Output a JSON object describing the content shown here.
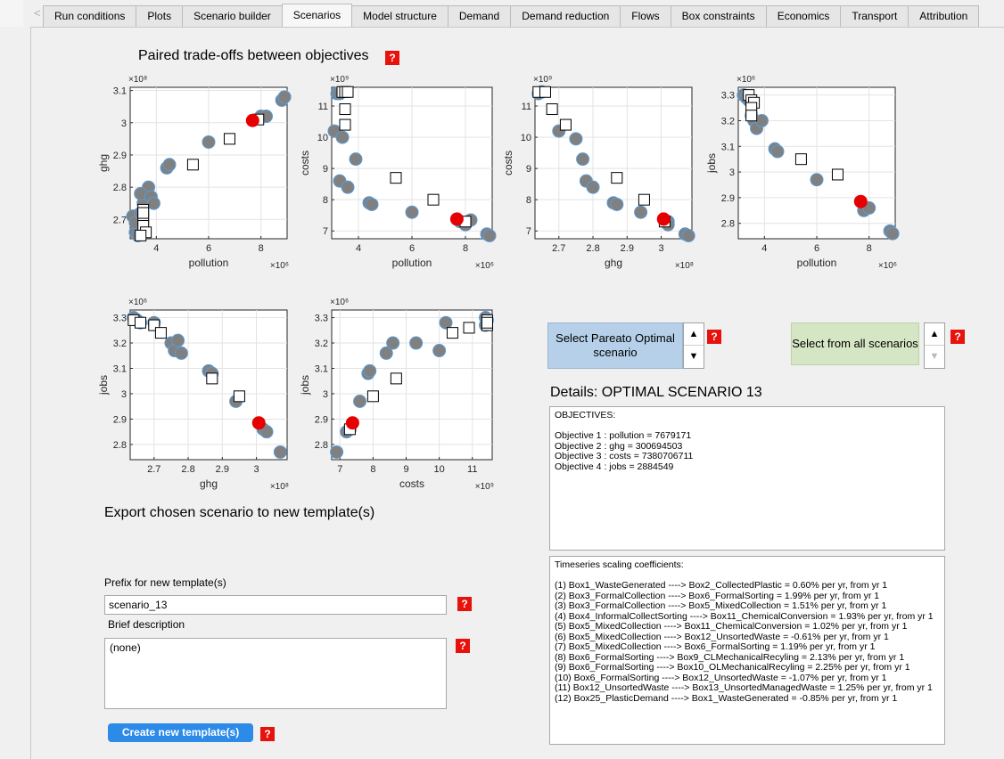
{
  "tabs": [
    "Run conditions",
    "Plots",
    "Scenario builder",
    "Scenarios",
    "Model structure",
    "Demand",
    "Demand reduction",
    "Flows",
    "Box constraints",
    "Economics",
    "Transport",
    "Attribution"
  ],
  "active_tab": "Scenarios",
  "heading": "Paired trade-offs between objectives",
  "help_label": "?",
  "plots": [
    {
      "xlabel": "pollution",
      "ylabel": "ghg",
      "x_exp": "×10⁶",
      "y_exp": "×10⁸",
      "xticks": [
        "4",
        "6",
        "8"
      ],
      "yticks": [
        "3.1",
        "3",
        "2.9",
        "2.8",
        "2.7"
      ],
      "xlim": [
        3.0,
        9.0
      ],
      "ylim": [
        2.64,
        3.11
      ],
      "gray": [
        [
          3.2,
          2.66
        ],
        [
          3.3,
          2.65
        ],
        [
          3.1,
          2.71
        ],
        [
          3.2,
          2.69
        ],
        [
          3.4,
          2.72
        ],
        [
          3.5,
          2.75
        ],
        [
          3.6,
          2.78
        ],
        [
          3.7,
          2.8
        ],
        [
          3.4,
          2.78
        ],
        [
          3.8,
          2.77
        ],
        [
          3.9,
          2.75
        ],
        [
          4.4,
          2.86
        ],
        [
          4.5,
          2.87
        ],
        [
          6.0,
          2.94
        ],
        [
          8.0,
          3.02
        ],
        [
          8.2,
          3.02
        ],
        [
          8.8,
          3.07
        ],
        [
          8.9,
          3.08
        ],
        [
          3.3,
          2.65
        ]
      ],
      "squares": [
        [
          3.5,
          2.73
        ],
        [
          3.5,
          2.7
        ],
        [
          3.5,
          2.68
        ],
        [
          3.6,
          2.66
        ],
        [
          3.4,
          2.65
        ],
        [
          5.4,
          2.87
        ],
        [
          6.8,
          2.95
        ],
        [
          7.9,
          3.01
        ],
        [
          3.5,
          2.72
        ]
      ],
      "red": [
        [
          7.68,
          3.007
        ]
      ]
    },
    {
      "xlabel": "pollution",
      "ylabel": "costs",
      "x_exp": "×10⁶",
      "y_exp": "×10⁹",
      "xticks": [
        "4",
        "6",
        "8"
      ],
      "yticks": [
        "11",
        "10",
        "9",
        "8",
        "7"
      ],
      "xlim": [
        3.0,
        9.0
      ],
      "ylim": [
        6.75,
        11.6
      ],
      "gray": [
        [
          3.2,
          11.4
        ],
        [
          3.3,
          11.4
        ],
        [
          3.1,
          10.2
        ],
        [
          3.4,
          10.0
        ],
        [
          3.3,
          8.6
        ],
        [
          3.6,
          8.4
        ],
        [
          3.9,
          9.3
        ],
        [
          4.4,
          7.9
        ],
        [
          4.5,
          7.85
        ],
        [
          6.0,
          7.6
        ],
        [
          7.8,
          7.3
        ],
        [
          8.0,
          7.2
        ],
        [
          8.2,
          7.35
        ],
        [
          8.8,
          6.9
        ],
        [
          8.9,
          6.85
        ]
      ],
      "squares": [
        [
          3.4,
          11.45
        ],
        [
          3.5,
          11.45
        ],
        [
          3.6,
          11.45
        ],
        [
          3.5,
          10.9
        ],
        [
          3.5,
          10.4
        ],
        [
          5.4,
          8.7
        ],
        [
          6.8,
          8.0
        ],
        [
          8.0,
          7.3
        ]
      ],
      "red": [
        [
          7.68,
          7.38
        ]
      ]
    },
    {
      "xlabel": "ghg",
      "ylabel": "costs",
      "x_exp": "×10⁸",
      "y_exp": "×10⁹",
      "xticks": [
        "2.7",
        "2.8",
        "2.9",
        "3",
        "3.1"
      ],
      "yticks": [
        "11",
        "10",
        "9",
        "8",
        "7"
      ],
      "xlim": [
        2.63,
        3.09
      ],
      "ylim": [
        6.75,
        11.6
      ],
      "gray": [
        [
          2.64,
          11.4
        ],
        [
          2.65,
          11.45
        ],
        [
          2.7,
          10.2
        ],
        [
          2.75,
          9.95
        ],
        [
          2.77,
          9.3
        ],
        [
          2.78,
          8.6
        ],
        [
          2.8,
          8.4
        ],
        [
          2.86,
          7.9
        ],
        [
          2.87,
          7.85
        ],
        [
          2.94,
          7.6
        ],
        [
          3.02,
          7.3
        ],
        [
          3.02,
          7.2
        ],
        [
          3.07,
          6.9
        ],
        [
          3.08,
          6.85
        ]
      ],
      "squares": [
        [
          2.64,
          11.45
        ],
        [
          2.66,
          11.45
        ],
        [
          2.68,
          10.9
        ],
        [
          2.72,
          10.4
        ],
        [
          2.87,
          8.7
        ],
        [
          2.95,
          8.0
        ],
        [
          3.01,
          7.3
        ]
      ],
      "red": [
        [
          3.007,
          7.38
        ]
      ]
    },
    {
      "xlabel": "pollution",
      "ylabel": "jobs",
      "x_exp": "×10⁶",
      "y_exp": "×10⁶",
      "xticks": [
        "4",
        "6",
        "8"
      ],
      "yticks": [
        "3.3",
        "3.2",
        "3.1",
        "3",
        "2.9",
        "2.8"
      ],
      "xlim": [
        3.0,
        9.0
      ],
      "ylim": [
        2.74,
        3.33
      ],
      "gray": [
        [
          3.2,
          3.3
        ],
        [
          3.3,
          3.29
        ],
        [
          3.4,
          3.28
        ],
        [
          3.5,
          3.22
        ],
        [
          3.6,
          3.2
        ],
        [
          3.7,
          3.17
        ],
        [
          3.9,
          3.2
        ],
        [
          4.4,
          3.09
        ],
        [
          4.5,
          3.08
        ],
        [
          6.0,
          2.97
        ],
        [
          7.8,
          2.85
        ],
        [
          8.0,
          2.86
        ],
        [
          8.8,
          2.77
        ],
        [
          8.9,
          2.76
        ]
      ],
      "squares": [
        [
          3.4,
          3.3
        ],
        [
          3.5,
          3.28
        ],
        [
          3.6,
          3.27
        ],
        [
          3.5,
          3.25
        ],
        [
          3.5,
          3.22
        ],
        [
          5.4,
          3.05
        ],
        [
          6.8,
          2.99
        ]
      ],
      "red": [
        [
          7.68,
          2.885
        ]
      ]
    },
    {
      "xlabel": "ghg",
      "ylabel": "jobs",
      "x_exp": "×10⁸",
      "y_exp": "×10⁶",
      "xticks": [
        "2.7",
        "2.8",
        "2.9",
        "3",
        "3.1"
      ],
      "yticks": [
        "3.3",
        "3.2",
        "3.1",
        "3",
        "2.9",
        "2.8"
      ],
      "xlim": [
        2.63,
        3.09
      ],
      "ylim": [
        2.74,
        3.33
      ],
      "gray": [
        [
          2.64,
          3.3
        ],
        [
          2.65,
          3.29
        ],
        [
          2.7,
          3.28
        ],
        [
          2.75,
          3.2
        ],
        [
          2.76,
          3.17
        ],
        [
          2.78,
          3.16
        ],
        [
          2.77,
          3.21
        ],
        [
          2.86,
          3.09
        ],
        [
          2.87,
          3.08
        ],
        [
          2.94,
          2.97
        ],
        [
          3.02,
          2.86
        ],
        [
          3.03,
          2.85
        ],
        [
          3.07,
          2.77
        ],
        [
          2.66,
          3.28
        ]
      ],
      "squares": [
        [
          2.64,
          3.29
        ],
        [
          2.66,
          3.28
        ],
        [
          2.7,
          3.27
        ],
        [
          2.72,
          3.24
        ],
        [
          2.87,
          3.06
        ],
        [
          2.95,
          2.99
        ]
      ],
      "red": [
        [
          3.007,
          2.885
        ]
      ]
    },
    {
      "xlabel": "costs",
      "ylabel": "jobs",
      "x_exp": "×10⁹",
      "y_exp": "×10⁶",
      "xticks": [
        "7",
        "8",
        "9",
        "10",
        "11"
      ],
      "yticks": [
        "3.3",
        "3.2",
        "3.1",
        "3",
        "2.9",
        "2.8"
      ],
      "xlim": [
        6.75,
        11.6
      ],
      "ylim": [
        2.74,
        3.33
      ],
      "gray": [
        [
          6.9,
          2.77
        ],
        [
          7.2,
          2.85
        ],
        [
          7.3,
          2.86
        ],
        [
          7.6,
          2.97
        ],
        [
          7.85,
          3.08
        ],
        [
          7.9,
          3.09
        ],
        [
          8.4,
          3.16
        ],
        [
          8.6,
          3.2
        ],
        [
          9.3,
          3.2
        ],
        [
          10.0,
          3.17
        ],
        [
          10.2,
          3.28
        ],
        [
          11.4,
          3.3
        ],
        [
          11.45,
          3.29
        ],
        [
          11.4,
          3.27
        ]
      ],
      "squares": [
        [
          7.3,
          2.86
        ],
        [
          8.0,
          2.99
        ],
        [
          8.7,
          3.06
        ],
        [
          10.4,
          3.24
        ],
        [
          10.9,
          3.26
        ],
        [
          11.45,
          3.27
        ],
        [
          11.45,
          3.29
        ],
        [
          11.45,
          3.28
        ]
      ],
      "red": [
        [
          7.38,
          2.885
        ]
      ]
    }
  ],
  "pareto_button": "Select Pareato Optimal scenario",
  "all_button": "Select from all scenarios",
  "spinner_up": "▲",
  "spinner_down": "▼",
  "details_title": "Details: OPTIMAL SCENARIO 13",
  "objectives_lines": [
    "OBJECTIVES:",
    "",
    "Objective 1 : pollution = 7679171",
    "Objective 2 : ghg = 300694503",
    "Objective 3 : costs = 7380706711",
    "Objective 4 : jobs = 2884549"
  ],
  "timeseries_lines": [
    "Timeseries scaling coefficients:",
    "",
    "(1) Box1_WasteGenerated ----> Box2_CollectedPlastic = 0.60% per yr, from yr 1",
    "(2) Box3_FormalCollection ----> Box6_FormalSorting = 1.99% per yr, from yr 1",
    "(3) Box3_FormalCollection ----> Box5_MixedCollection = 1.51% per yr, from yr 1",
    "(4) Box4_InformalCollectSorting ----> Box11_ChemicalConversion = 1.93% per yr, from yr 1",
    "(5) Box5_MixedCollection ----> Box11_ChemicalConversion = 1.02% per yr, from yr 1",
    "(6) Box5_MixedCollection ----> Box12_UnsortedWaste = -0.61% per yr, from yr 1",
    "(7) Box5_MixedCollection ----> Box6_FormalSorting = 1.19% per yr, from yr 1",
    "(8) Box6_FormalSorting ----> Box9_CLMechanicalRecyling = 2.13% per yr, from yr 1",
    "(9) Box6_FormalSorting ----> Box10_OLMechanicalRecyling = 2.25% per yr, from yr 1",
    "(10) Box6_FormalSorting ----> Box12_UnsortedWaste = -1.07% per yr, from yr 1",
    "(11) Box12_UnsortedWaste ----> Box13_UnsortedManagedWaste = 1.25% per yr, from yr 1",
    "(12) Box25_PlasticDemand ----> Box1_WasteGenerated = -0.85% per yr, from yr 1"
  ],
  "export_title": "Export chosen scenario to new template(s)",
  "prefix_label": "Prefix for new template(s)",
  "prefix_value": "scenario_13",
  "desc_label": "Brief description",
  "desc_value": "(none)",
  "create_button": "Create new template(s)",
  "colors": {
    "gray_marker": "#808080",
    "marker_edge": "#5a9bd5",
    "red_marker": "#e60000",
    "help_bg": "#e8120c",
    "create_btn": "#2c8ae8"
  }
}
